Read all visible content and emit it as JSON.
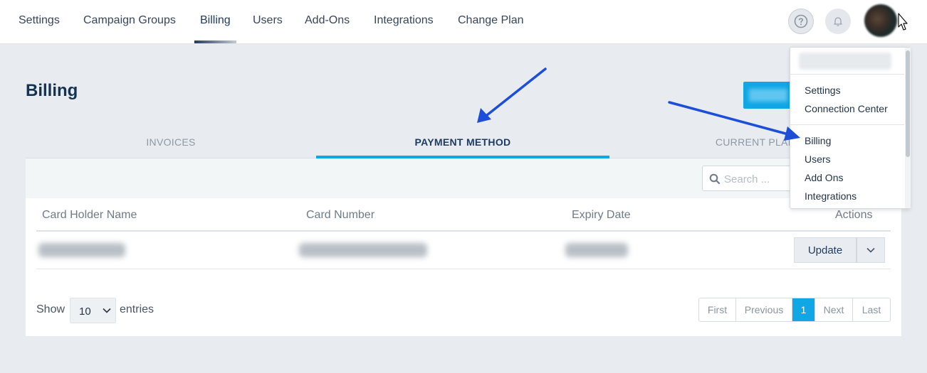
{
  "nav": {
    "items": [
      {
        "label": "Settings"
      },
      {
        "label": "Campaign Groups"
      },
      {
        "label": "Billing"
      },
      {
        "label": "Users"
      },
      {
        "label": "Add-Ons"
      },
      {
        "label": "Integrations"
      },
      {
        "label": "Change Plan"
      }
    ],
    "active": "Billing"
  },
  "page": {
    "title": "Billing"
  },
  "tabs": [
    {
      "label": "INVOICES"
    },
    {
      "label": "PAYMENT METHOD"
    },
    {
      "label": "CURRENT PLAN"
    }
  ],
  "search": {
    "placeholder": "Search ..."
  },
  "table": {
    "headers": [
      "Card Holder Name",
      "Card Number",
      "Expiry Date",
      "Actions"
    ],
    "row": {
      "update_label": "Update"
    }
  },
  "length": {
    "show": "Show",
    "value": "10",
    "entries": "entries"
  },
  "pagination": {
    "first": "First",
    "previous": "Previous",
    "current": "1",
    "next": "Next",
    "last": "Last"
  },
  "dropdown": {
    "items": [
      {
        "label": "Settings"
      },
      {
        "label": "Connection Center"
      },
      {
        "label": "Billing"
      },
      {
        "label": "Users"
      },
      {
        "label": "Add Ons"
      },
      {
        "label": "Integrations"
      }
    ]
  },
  "colors": {
    "accent": "#11a6e4",
    "navy": "#16324f",
    "arrow": "#1d4ed8",
    "background": "#e8ecf0"
  }
}
